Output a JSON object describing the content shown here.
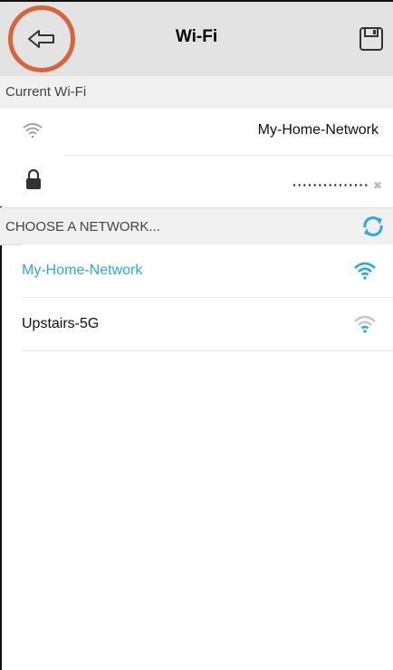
{
  "header": {
    "title": "Wi-Fi"
  },
  "current": {
    "section_label": "Current Wi-Fi",
    "ssid": "My-Home-Network",
    "password_masked": "···············",
    "clear_label": "✖"
  },
  "choose": {
    "section_label": "CHOOSE A NETWORK..."
  },
  "networks": [
    {
      "name": "My-Home-Network",
      "selected": true
    },
    {
      "name": "Upstairs-5G",
      "selected": false
    }
  ],
  "colors": {
    "accent": "#2ba8e8",
    "highlight": "#d9643a",
    "header_bg": "#e3e3e3"
  },
  "icons": {
    "back": "back-arrow-icon",
    "save": "save-icon",
    "wifi": "wifi-icon",
    "lock": "lock-icon",
    "refresh": "refresh-icon"
  }
}
